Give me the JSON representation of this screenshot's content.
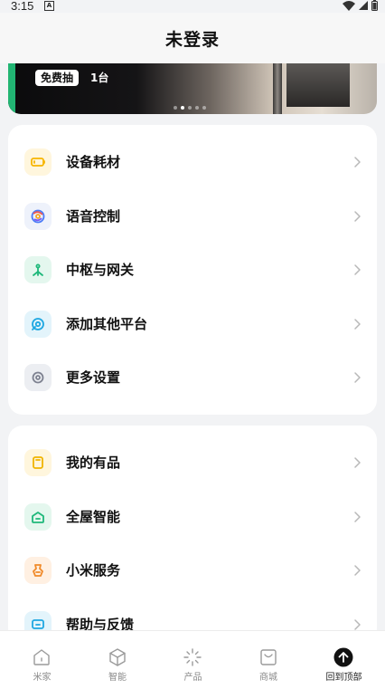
{
  "status_bar": {
    "time": "3:15",
    "notif_icon": "A"
  },
  "header": {
    "title": "未登录"
  },
  "banner": {
    "badge": "免费抽",
    "count": "1台",
    "dot_count": 5,
    "active_dot": 1
  },
  "group1": [
    {
      "label": "设备耗材",
      "icon": "battery-icon",
      "color": "#f7b500",
      "bg": "#fff6dd"
    },
    {
      "label": "语音控制",
      "icon": "voice-assistant-icon",
      "color": "#4a7bf7",
      "bg": "#eef2fb"
    },
    {
      "label": "中枢与网关",
      "icon": "hub-icon",
      "color": "#1fb87a",
      "bg": "#e4f7ee"
    },
    {
      "label": "添加其他平台",
      "icon": "add-platform-icon",
      "color": "#1ea7e1",
      "bg": "#e3f4fb"
    },
    {
      "label": "更多设置",
      "icon": "settings-gear-icon",
      "color": "#7d8190",
      "bg": "#eceef2"
    }
  ],
  "group2": [
    {
      "label": "我的有品",
      "icon": "youpin-bag-icon",
      "color": "#f0b400",
      "bg": "#fff6dd"
    },
    {
      "label": "全屋智能",
      "icon": "smart-home-icon",
      "color": "#1fb87a",
      "bg": "#e4f7ee"
    },
    {
      "label": "小米服务",
      "icon": "service-icon",
      "color": "#f08a2a",
      "bg": "#fff0e2"
    },
    {
      "label": "帮助与反馈",
      "icon": "feedback-icon",
      "color": "#1ea7e1",
      "bg": "#e3f4fb"
    }
  ],
  "tabs": [
    {
      "label": "米家",
      "icon": "home-icon"
    },
    {
      "label": "智能",
      "icon": "smart-cube-icon"
    },
    {
      "label": "产品",
      "icon": "products-sparkle-icon"
    },
    {
      "label": "商城",
      "icon": "store-bag-icon"
    },
    {
      "label": "回到顶部",
      "icon": "back-to-top-icon",
      "active": true
    }
  ]
}
